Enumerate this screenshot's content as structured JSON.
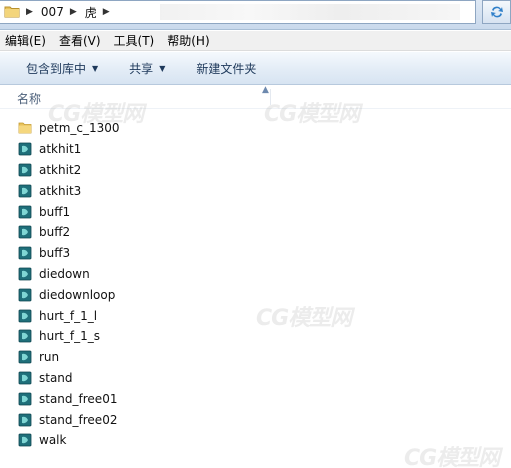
{
  "address": {
    "crumbs": [
      "007",
      "虎"
    ]
  },
  "menu": [
    "编辑(E)",
    "查看(V)",
    "工具(T)",
    "帮助(H)"
  ],
  "toolbar": {
    "include_library": "包含到库中",
    "share": "共享",
    "new_folder": "新建文件夹"
  },
  "columns": {
    "name": "名称"
  },
  "files": [
    {
      "name": "petm_c_1300",
      "icon": "folder-icon"
    },
    {
      "name": "atkhit1",
      "icon": "file-icon"
    },
    {
      "name": "atkhit2",
      "icon": "file-icon"
    },
    {
      "name": "atkhit3",
      "icon": "file-icon"
    },
    {
      "name": "buff1",
      "icon": "file-icon"
    },
    {
      "name": "buff2",
      "icon": "file-icon"
    },
    {
      "name": "buff3",
      "icon": "file-icon"
    },
    {
      "name": "diedown",
      "icon": "file-icon"
    },
    {
      "name": "diedownloop",
      "icon": "file-icon"
    },
    {
      "name": "hurt_f_1_l",
      "icon": "file-icon"
    },
    {
      "name": "hurt_f_1_s",
      "icon": "file-icon"
    },
    {
      "name": "run",
      "icon": "file-icon"
    },
    {
      "name": "stand",
      "icon": "file-icon"
    },
    {
      "name": "stand_free01",
      "icon": "file-icon"
    },
    {
      "name": "stand_free02",
      "icon": "file-icon"
    },
    {
      "name": "walk",
      "icon": "file-icon"
    }
  ],
  "watermark": "CG模型网",
  "colors": {
    "command_text": "#1e395b",
    "header_text": "#4c607a",
    "folder": "#e8c25a",
    "file_icon": "#1f6f7a"
  }
}
